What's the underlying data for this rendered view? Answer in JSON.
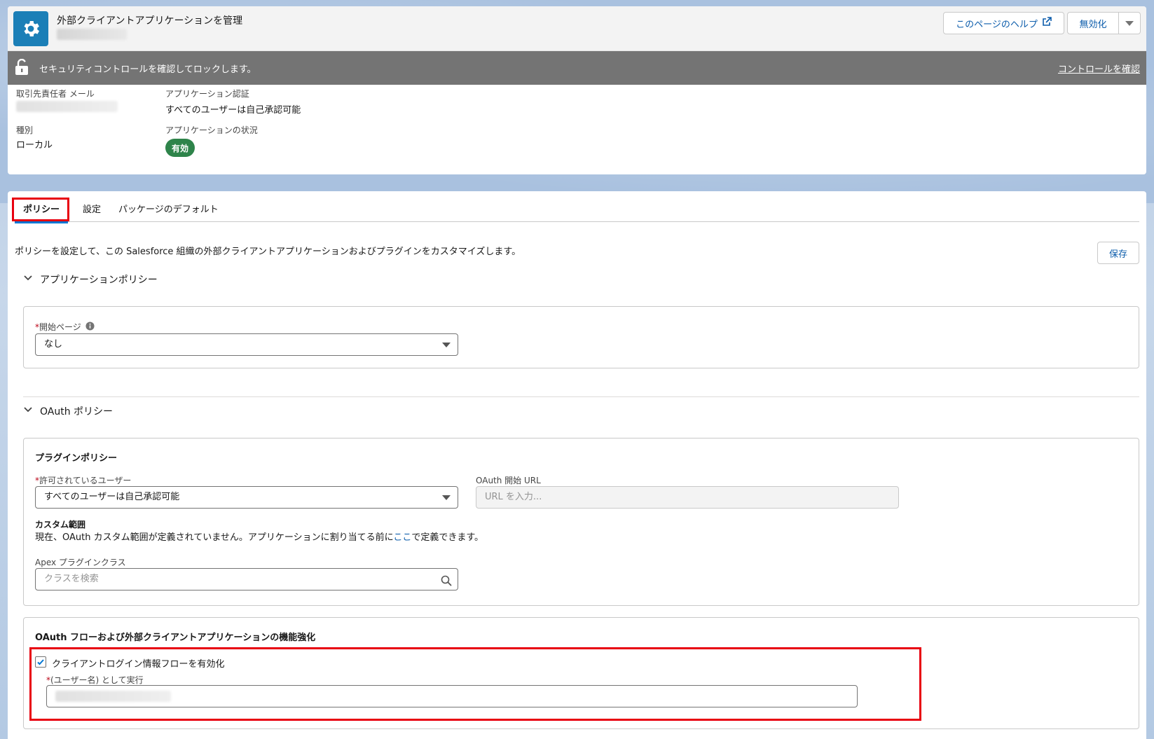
{
  "header": {
    "title": "外部クライアントアプリケーションを管理",
    "help_button": "このページのヘルプ",
    "disable_button": "無効化"
  },
  "lock_bar": {
    "message": "セキュリティコントロールを確認してロックします。",
    "link": "コントロールを確認"
  },
  "details": {
    "contact_email_label": "取引先責任者 メール",
    "app_auth_label": "アプリケーション認証",
    "app_auth_value": "すべてのユーザーは自己承認可能",
    "type_label": "種別",
    "type_value": "ローカル",
    "status_label": "アプリケーションの状況",
    "status_value": "有効"
  },
  "tabs": [
    "ポリシー",
    "設定",
    "パッケージのデフォルト"
  ],
  "main": {
    "description": "ポリシーを設定して、この Salesforce 組織の外部クライアントアプリケーションおよびプラグインをカスタマイズします。",
    "save_button": "保存"
  },
  "app_policy": {
    "section_title": "アプリケーションポリシー",
    "start_page_label": "開始ページ",
    "start_page_value": "なし"
  },
  "oauth_policy": {
    "section_title": "OAuth ポリシー",
    "plugin_policy_title": "プラグインポリシー",
    "permitted_users_label": "許可されているユーザー",
    "permitted_users_value": "すべてのユーザーは自己承認可能",
    "oauth_start_url_label": "OAuth 開始 URL",
    "oauth_start_url_placeholder": "URL を入力...",
    "custom_scope_title": "カスタム範囲",
    "custom_scope_text_before": "現在、OAuth カスタム範囲が定義されていません。アプリケーションに割り当てる前に",
    "custom_scope_link": "ここ",
    "custom_scope_text_after": "で定義できます。",
    "apex_plugin_label": "Apex プラグインクラス",
    "apex_plugin_placeholder": "クラスを検索"
  },
  "oauth_flows": {
    "title": "OAuth フローおよび外部クライアントアプリケーションの機能強化",
    "client_credentials_label": "クライアントログイン情報フローを有効化",
    "client_credentials_checked": true,
    "run_as_label": "(ユーザー名) として実行"
  },
  "colors": {
    "brand": "#0176d3",
    "link": "#0b5cab",
    "success": "#2e844a",
    "highlight": "#e8000f",
    "lock_bar": "#747474"
  }
}
